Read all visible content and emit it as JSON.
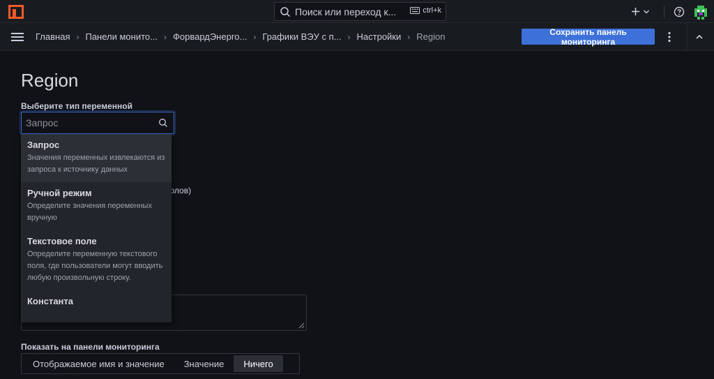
{
  "search": {
    "placeholder": "Поиск или переход к...",
    "shortcut": "ctrl+k"
  },
  "topbar": {
    "add_label": "+",
    "icons": [
      "logo-icon",
      "search-icon",
      "keyboard-icon",
      "plus-icon",
      "chevron-down-icon",
      "help-icon",
      "avatar"
    ]
  },
  "breadcrumbs": [
    "Главная",
    "Панели монито...",
    "ФорвардЭнерго...",
    "Графики ВЭУ с п...",
    "Настройки",
    "Region"
  ],
  "toolbar": {
    "save_label": "Сохранить панель мониторинга"
  },
  "page": {
    "title": "Region"
  },
  "variable_type": {
    "label": "Выберите тип переменной",
    "placeholder": "Запрос",
    "options": [
      {
        "title": "Запрос",
        "description": "Значения переменных извлекаются из запроса к источнику данных"
      },
      {
        "title": "Ручной режим",
        "description": "Определите значения переменных вручную"
      },
      {
        "title": "Текстовое поле",
        "description": "Определите переменную текстового поля, где пользователи могут вводить любую произвольную строку."
      },
      {
        "title": "Константа",
        "description": ""
      }
    ]
  },
  "background": {
    "partial_text": "мволов)"
  },
  "display": {
    "label": "Показать на панели мониторинга",
    "options": [
      "Отображаемое имя и значение",
      "Значение",
      "Ничего"
    ],
    "selected": "Ничего"
  },
  "colors": {
    "accent": "#3d71d9",
    "background": "#111217",
    "panel": "#181b1f",
    "dropdown": "#22252b"
  }
}
